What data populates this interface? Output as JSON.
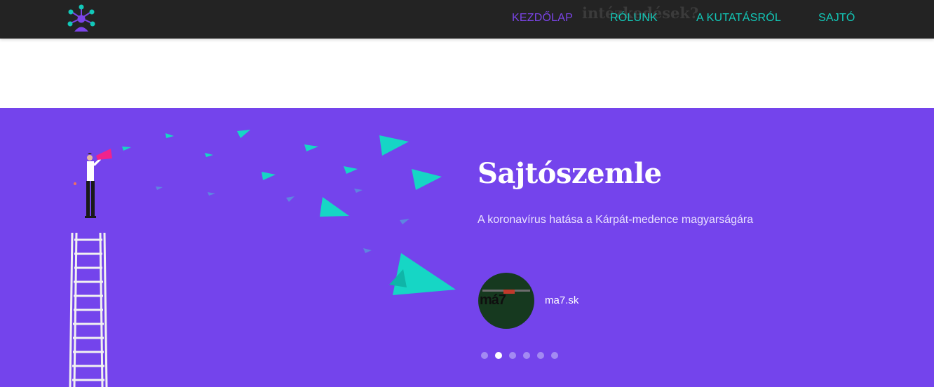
{
  "nav": {
    "ghost_text": "intézkedések?",
    "links": [
      {
        "label": "KEZDŐLAP",
        "active": true
      },
      {
        "label": "RÓLUNK",
        "active": false
      },
      {
        "label": "A KUTATÁSRÓL",
        "active": false
      },
      {
        "label": "SAJTÓ",
        "active": false
      }
    ]
  },
  "hero": {
    "title": "Sajtószemle",
    "subtitle": "A koronavírus hatása a Kárpát-medence magyarságára",
    "source": {
      "logo_text": "má7",
      "name": "ma7.sk"
    },
    "slider": {
      "total": 6,
      "active_index": 1
    }
  },
  "colors": {
    "navbar": "#232323",
    "nav_link": "#12c8b8",
    "nav_active": "#7b44e8",
    "hero_bg": "#7444ec",
    "plane": "#16d6c5",
    "megaphone": "#f0238c"
  }
}
